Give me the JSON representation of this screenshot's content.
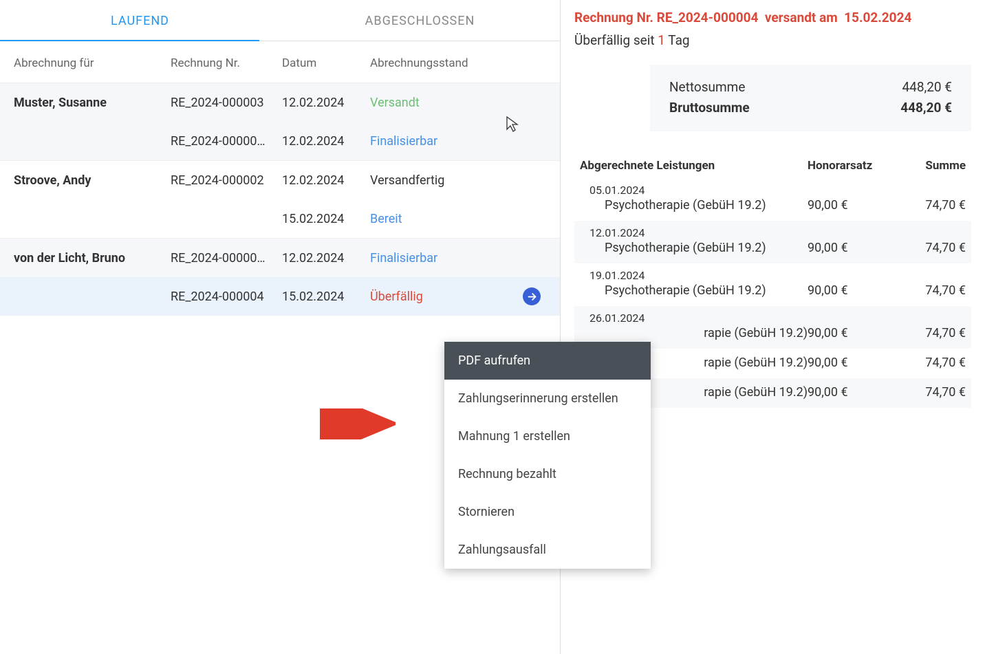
{
  "tabs": {
    "running": "LAUFEND",
    "completed": "ABGESCHLOSSEN"
  },
  "table_headers": {
    "patient": "Abrechnung für",
    "invoice": "Rechnung Nr.",
    "date": "Datum",
    "status": "Abrechnungsstand"
  },
  "groups": [
    {
      "name": "Muster, Susanne",
      "rows": [
        {
          "invoice": "RE_2024-000003",
          "date": "12.02.2024",
          "status": "Versandt",
          "status_class": "status-sent"
        },
        {
          "invoice": "RE_2024-00000…",
          "date": "12.02.2024",
          "status": "Finalisierbar",
          "status_class": "status-final"
        }
      ]
    },
    {
      "name": "Stroove, Andy",
      "rows": [
        {
          "invoice": "RE_2024-000002",
          "date": "12.02.2024",
          "status": "Versandfertig",
          "status_class": "status-ready-send"
        },
        {
          "invoice": "",
          "date": "15.02.2024",
          "status": "Bereit",
          "status_class": "status-ready"
        }
      ]
    },
    {
      "name": "von der Licht, Bruno",
      "rows": [
        {
          "invoice": "RE_2024-00000…",
          "date": "12.02.2024",
          "status": "Finalisierbar",
          "status_class": "status-final"
        },
        {
          "invoice": "RE_2024-000004",
          "date": "15.02.2024",
          "status": "Überfällig",
          "status_class": "status-overdue",
          "selected": true
        }
      ]
    }
  ],
  "detail": {
    "header_prefix": "Rechnung Nr.",
    "invoice_no": "RE_2024-000004",
    "sent_label": "versandt am",
    "sent_date": "15.02.2024",
    "overdue_prefix": "Überfällig seit",
    "overdue_days": "1",
    "overdue_suffix": "Tag",
    "net_label": "Nettosumme",
    "net_value": "448,20 €",
    "gross_label": "Bruttosumme",
    "gross_value": "448,20 €",
    "services_header": {
      "desc": "Abgerechnete Leistungen",
      "rate": "Honorarsatz",
      "sum": "Summe"
    },
    "services": [
      {
        "date": "05.01.2024",
        "desc": "Psychotherapie (GebüH 19.2)",
        "rate": "90,00 €",
        "sum": "74,70 €"
      },
      {
        "date": "12.01.2024",
        "desc": "Psychotherapie (GebüH 19.2)",
        "rate": "90,00 €",
        "sum": "74,70 €"
      },
      {
        "date": "19.01.2024",
        "desc": "Psychotherapie (GebüH 19.2)",
        "rate": "90,00 €",
        "sum": "74,70 €"
      },
      {
        "date": "26.01.2024",
        "desc": "rapie (GebüH 19.2)",
        "rate": "90,00 €",
        "sum": "74,70 €"
      },
      {
        "date": "",
        "desc": "rapie (GebüH 19.2)",
        "rate": "90,00 €",
        "sum": "74,70 €"
      },
      {
        "date": "",
        "desc": "rapie (GebüH 19.2)",
        "rate": "90,00 €",
        "sum": "74,70 €"
      }
    ]
  },
  "context_menu": [
    "PDF aufrufen",
    "Zahlungserinnerung erstellen",
    "Mahnung 1 erstellen",
    "Rechnung bezahlt",
    "Stornieren",
    "Zahlungsausfall"
  ]
}
